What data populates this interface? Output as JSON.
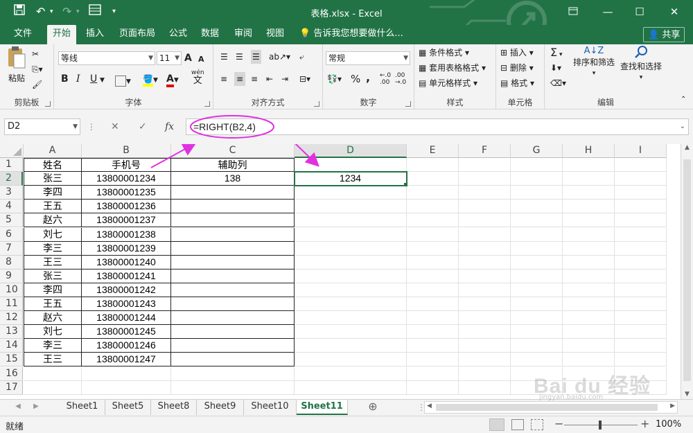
{
  "titlebar": {
    "title": "表格.xlsx - Excel",
    "restore_icon": "ribbon-display-icon",
    "minimize": "—",
    "maximize": "☐",
    "close": "✕"
  },
  "menu": {
    "tabs": [
      {
        "label": "文件"
      },
      {
        "label": "开始"
      },
      {
        "label": "插入"
      },
      {
        "label": "页面布局"
      },
      {
        "label": "公式"
      },
      {
        "label": "数据"
      },
      {
        "label": "审阅"
      },
      {
        "label": "视图"
      }
    ],
    "tell_me": "告诉我您想要做什么...",
    "share": "共享"
  },
  "ribbon": {
    "clipboard": {
      "label": "剪贴板",
      "paste": "粘贴"
    },
    "font": {
      "label": "字体",
      "font_name": "等线",
      "font_size": "11",
      "bold": "B",
      "italic": "I",
      "underline": "U",
      "grow": "A",
      "shrink": "A",
      "font_color_letter": "A",
      "wen": "wén",
      "wen_char": "文"
    },
    "alignment": {
      "label": "对齐方式"
    },
    "number": {
      "label": "数字",
      "format": "常规",
      "percent": "%",
      "comma": ","
    },
    "styles": {
      "label": "样式",
      "conditional": "条件格式",
      "table": "套用表格格式",
      "cell_styles": "单元格样式"
    },
    "cells": {
      "label": "单元格",
      "insert": "插入",
      "delete": "删除",
      "format": "格式"
    },
    "editing": {
      "label": "编辑",
      "sigma": "Σ",
      "sort_filter": "排序和筛选",
      "find_select": "查找和选择",
      "sort_az": "A↓Z"
    }
  },
  "formula_bar": {
    "name_box": "D2",
    "cancel": "✕",
    "enter": "✓",
    "fx": "fx",
    "formula": "=RIGHT(B2,4)"
  },
  "sheet": {
    "columns": [
      "A",
      "B",
      "C",
      "D",
      "E",
      "F",
      "G",
      "H",
      "I"
    ],
    "selected_column": "D",
    "selected_row": "2",
    "rows": [
      {
        "num": "1",
        "cells": [
          "姓名",
          "手机号",
          "辅助列",
          ""
        ]
      },
      {
        "num": "2",
        "cells": [
          "张三",
          "13800001234",
          "138",
          "1234"
        ]
      },
      {
        "num": "3",
        "cells": [
          "李四",
          "13800001235",
          "",
          ""
        ]
      },
      {
        "num": "4",
        "cells": [
          "王五",
          "13800001236",
          "",
          ""
        ]
      },
      {
        "num": "5",
        "cells": [
          "赵六",
          "13800001237",
          "",
          ""
        ]
      },
      {
        "num": "6",
        "cells": [
          "刘七",
          "13800001238",
          "",
          ""
        ]
      },
      {
        "num": "7",
        "cells": [
          "李三",
          "13800001239",
          "",
          ""
        ]
      },
      {
        "num": "8",
        "cells": [
          "王三",
          "13800001240",
          "",
          ""
        ]
      },
      {
        "num": "9",
        "cells": [
          "张三",
          "13800001241",
          "",
          ""
        ]
      },
      {
        "num": "10",
        "cells": [
          "李四",
          "13800001242",
          "",
          ""
        ]
      },
      {
        "num": "11",
        "cells": [
          "王五",
          "13800001243",
          "",
          ""
        ]
      },
      {
        "num": "12",
        "cells": [
          "赵六",
          "13800001244",
          "",
          ""
        ]
      },
      {
        "num": "13",
        "cells": [
          "刘七",
          "13800001245",
          "",
          ""
        ]
      },
      {
        "num": "14",
        "cells": [
          "李三",
          "13800001246",
          "",
          ""
        ]
      },
      {
        "num": "15",
        "cells": [
          "王三",
          "13800001247",
          "",
          ""
        ]
      },
      {
        "num": "16",
        "cells": [
          "",
          "",
          "",
          ""
        ]
      },
      {
        "num": "17",
        "cells": [
          "",
          "",
          "",
          ""
        ]
      }
    ]
  },
  "sheet_tabs": {
    "tabs": [
      "Sheet1",
      "Sheet5",
      "Sheet8",
      "Sheet9",
      "Sheet10",
      "Sheet11"
    ],
    "active": "Sheet11",
    "add": "⊕"
  },
  "status": {
    "ready": "就绪",
    "zoom": "100%",
    "minus": "−",
    "plus": "+"
  },
  "watermark": {
    "brand": "Bai du 经验",
    "url": "jingyan.baidu.com"
  },
  "colors": {
    "excel_green": "#217346",
    "annotation": "#e030e0"
  }
}
